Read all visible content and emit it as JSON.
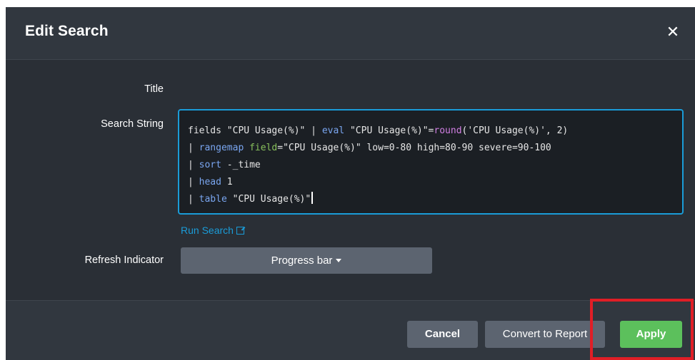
{
  "dialog": {
    "title": "Edit Search",
    "close_icon": "close-icon"
  },
  "form": {
    "title_label": "Title",
    "search_label": "Search String",
    "refresh_label": "Refresh Indicator",
    "run_search_label": "Run Search",
    "refresh_value": "Progress bar"
  },
  "search_string": {
    "lines": [
      "fields \"CPU Usage(%)\" | eval \"CPU Usage(%)\"=round('CPU Usage(%)', 2)",
      "| rangemap field=\"CPU Usage(%)\" low=0-80 high=80-90 severe=90-100",
      "| sort -_time",
      "| head 1",
      "| table \"CPU Usage(%)\""
    ],
    "tokens": {
      "l1_a": "fields \"CPU Usage(%)\" | ",
      "l1_eval": "eval",
      "l1_b": " \"CPU Usage(%)\"=",
      "l1_round": "round",
      "l1_c": "('CPU Usage(%)', 2)",
      "l2_pipe": "| ",
      "l2_cmd": "rangemap",
      "l2_sp": " ",
      "l2_field": "field",
      "l2_rest": "=\"CPU Usage(%)\" low=0-80 high=80-90 severe=90-100",
      "l3_pipe": "| ",
      "l3_cmd": "sort",
      "l3_rest": " -_time",
      "l4_pipe": "| ",
      "l4_cmd": "head",
      "l4_rest": " 1",
      "l5_pipe": "| ",
      "l5_cmd": "table",
      "l5_rest": " \"CPU Usage(%)\""
    }
  },
  "footer": {
    "cancel_label": "Cancel",
    "convert_label": "Convert to Report",
    "apply_label": "Apply"
  },
  "colors": {
    "dialog_bg": "#2a2f36",
    "header_bg": "#31373f",
    "accent_blue": "#1a9cd8",
    "apply_green": "#5cc05c",
    "highlight_red": "#e01e26"
  }
}
